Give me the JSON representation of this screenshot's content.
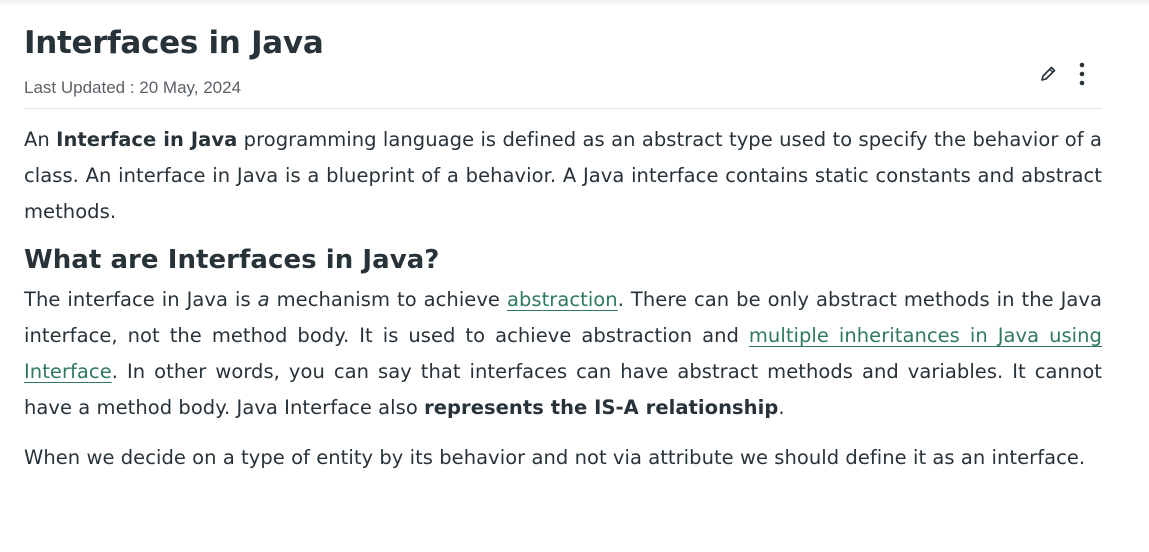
{
  "article": {
    "title": "Interfaces in Java",
    "last_updated": "Last Updated : 20 May, 2024",
    "actions": {
      "edit_icon": "pencil-icon",
      "more_icon": "vertical-dots-icon"
    },
    "p1": {
      "t1": "An ",
      "b1": "Interface in Java",
      "t2": " programming language is defined as an abstract type used to specify the behavior of a class. An interface in Java is a blueprint of a behavior. A Java interface contains static constants and abstract methods."
    },
    "h2": "What are Interfaces in Java?",
    "p2": {
      "t1": "The interface in Java is ",
      "i1": "a",
      "t2": " mechanism to achieve ",
      "link1": "abstraction",
      "t3": ". There can be only abstract methods in the Java interface, not the method body. It is used to achieve abstraction and ",
      "link2": "multiple inheritances in Java using Interface",
      "t4": ". In other words, you can say that interfaces can have abstract methods and variables. It cannot have a method body. Java Interface also ",
      "b1": "represents the IS-A relationship",
      "t5": "."
    },
    "p3": "When we decide on a type of entity by its behavior and not via attribute we should define it as an interface."
  },
  "colors": {
    "text": "#273239",
    "link": "#2f7a5c",
    "muted": "#5b6168",
    "divider": "#e4e4e4"
  }
}
